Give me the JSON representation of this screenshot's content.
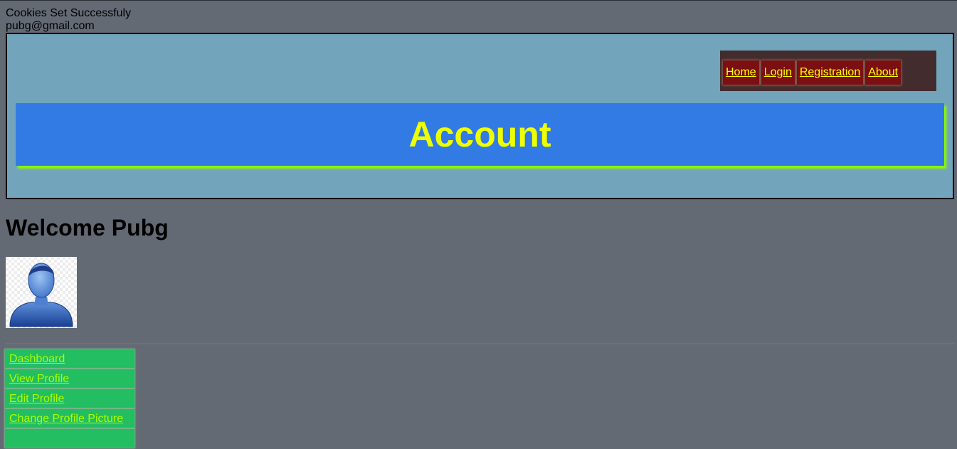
{
  "status": {
    "message": "Cookies Set Successfuly",
    "email": "pubg@gmail.com"
  },
  "nav": {
    "items": [
      {
        "label": "Home"
      },
      {
        "label": "Login"
      },
      {
        "label": "Registration"
      },
      {
        "label": "About"
      }
    ]
  },
  "banner": {
    "title": "Account"
  },
  "welcome": {
    "text": "Welcome Pubg"
  },
  "avatar": {
    "icon": "user-avatar-icon"
  },
  "sidemenu": {
    "items": [
      {
        "label": "Dashboard"
      },
      {
        "label": "View Profile"
      },
      {
        "label": "Edit Profile"
      },
      {
        "label": "Change Profile Picture"
      },
      {
        "label": ""
      }
    ]
  },
  "colors": {
    "page_bg": "#646a74",
    "header_bg": "#72a5bc",
    "banner_bg": "#327be4",
    "banner_text": "#eeff00",
    "nav_bg": "#432c2e",
    "nav_item_bg": "#7b0f12",
    "nav_link": "#ffff00",
    "sidemenu_bg": "#23bd62",
    "sidemenu_link": "#aaff00"
  }
}
